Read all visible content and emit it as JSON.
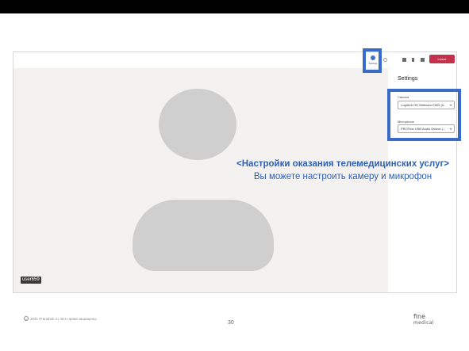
{
  "app": {
    "settings_title": "Settings",
    "camera": {
      "label": "Camera",
      "value": "Logitech HD Webcam C525 (0..."
    },
    "microphone": {
      "label": "Microphone",
      "value": "PROTrue USB Audio Device (..."
    },
    "leave_label": "Leave",
    "settings_button_label": "Settings",
    "user_name": "user659"
  },
  "caption": {
    "title": "<Настройки оказания телемедицинских услуг>",
    "subtitle": "Вы можете настроить камеру и микрофон"
  },
  "footer": {
    "copyright": "2021 Pranabok.ru. Все права защищены.",
    "page_number": "30",
    "logo_line1": "fine",
    "logo_line2": "medical"
  },
  "colors": {
    "highlight": "#3b6bc9",
    "caption": "#2f5fb4",
    "leave_button": "#c4314b"
  }
}
